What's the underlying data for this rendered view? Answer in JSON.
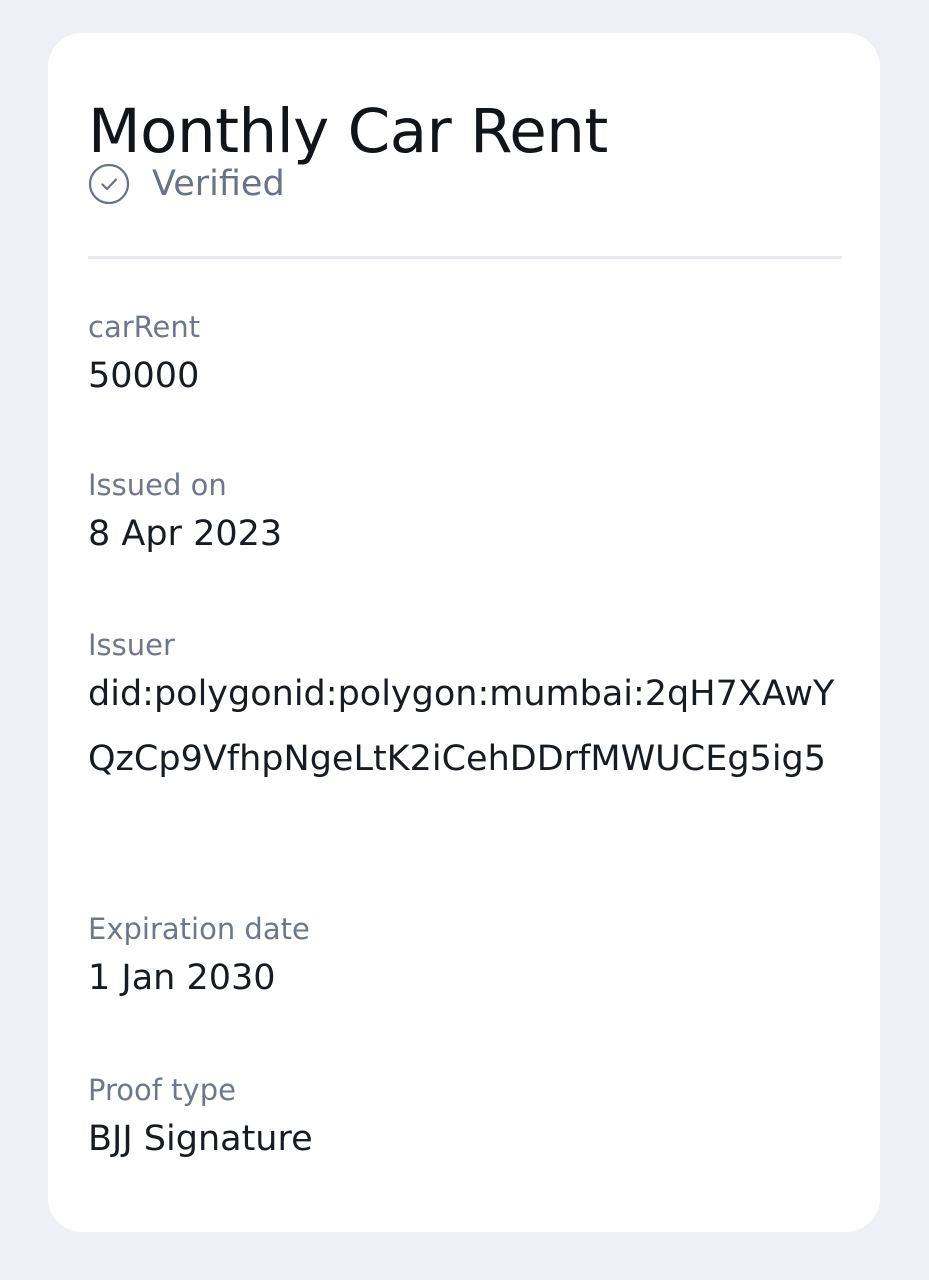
{
  "card": {
    "title": "Monthly Car Rent",
    "status": {
      "label": "Verified",
      "icon": "check-circle-icon"
    },
    "fields": [
      {
        "label": "carRent",
        "value": "50000"
      },
      {
        "label": "Issued on",
        "value": "8 Apr 2023"
      },
      {
        "label": "Issuer",
        "value": "did:polygonid:polygon:mumbai:2qH7XAwYQzCp9VfhpNgeLtK2iCehDDrfMWUCEg5ig5"
      },
      {
        "label": "Expiration date",
        "value": "1 Jan 2030"
      },
      {
        "label": "Proof type",
        "value": "BJJ Signature"
      }
    ]
  },
  "colors": {
    "background": "#eef0f5",
    "card": "#ffffff",
    "title": "#111418",
    "label": "#6f778a",
    "value": "#171b22",
    "status": "#6a7285"
  }
}
